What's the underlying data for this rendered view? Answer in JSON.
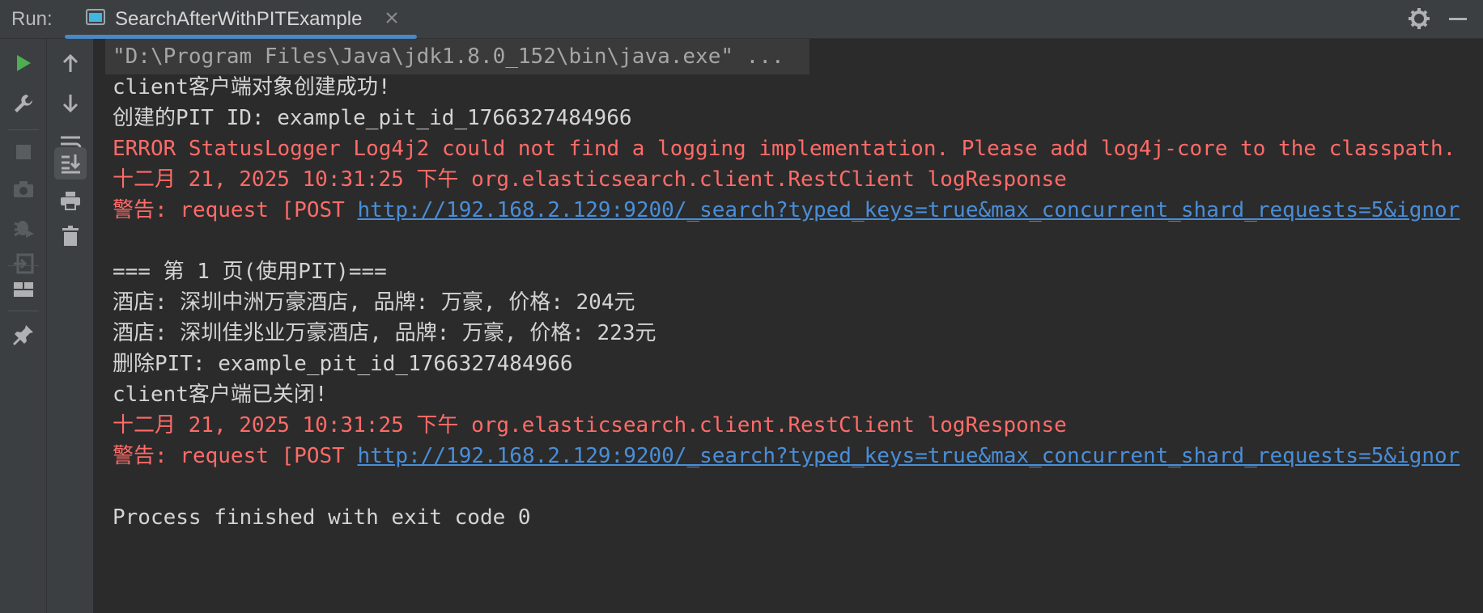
{
  "header": {
    "run_label": "Run:",
    "tab_title": "SearchAfterWithPITExample",
    "icons": [
      "run-config-icon",
      "close-icon",
      "gear-icon",
      "minimize-icon"
    ]
  },
  "rail": {
    "icons": [
      "play-icon",
      "wrench-icon",
      "stop-icon",
      "camera-icon",
      "debug-icon",
      "exit-icon",
      "layout-icon",
      "pin-icon"
    ]
  },
  "second_rail": {
    "icons": [
      "arrow-up-icon",
      "arrow-down-icon",
      "soft-wrap-icon",
      "scroll-to-end-icon",
      "print-icon",
      "trash-icon"
    ]
  },
  "console": {
    "cmd": "\"D:\\Program Files\\Java\\jdk1.8.0_152\\bin\\java.exe\" ...",
    "l2": "client客户端对象创建成功!",
    "l3": "创建的PIT ID: example_pit_id_1766327484966",
    "l4": "ERROR StatusLogger Log4j2 could not find a logging implementation. Please add log4j-core to the classpath.",
    "l5": "十二月 21, 2025 10:31:25 下午 org.elasticsearch.client.RestClient logResponse",
    "l6_prefix": "警告: request [POST ",
    "l6_link": "http://192.168.2.129:9200/_search?typed_keys=true&max_concurrent_shard_requests=5&ignor",
    "l8": "=== 第 1 页(使用PIT)===",
    "l9": "酒店: 深圳中洲万豪酒店, 品牌: 万豪, 价格: 204元",
    "l10": "酒店: 深圳佳兆业万豪酒店, 品牌: 万豪, 价格: 223元",
    "l11": "删除PIT: example_pit_id_1766327484966",
    "l12": "client客户端已关闭!",
    "l13": "十二月 21, 2025 10:31:25 下午 org.elasticsearch.client.RestClient logResponse",
    "l14_prefix": "警告: request [POST ",
    "l14_link": "http://192.168.2.129:9200/_search?typed_keys=true&max_concurrent_shard_requests=5&ignor",
    "l16": "Process finished with exit code 0"
  },
  "colors": {
    "background": "#2b2b2b",
    "toolbar": "#3c3f41",
    "text": "#d4d4d4",
    "error": "#ff6b68",
    "link": "#4a8ed8",
    "run_green": "#4caf50",
    "tab_underline": "#4a88c7"
  }
}
